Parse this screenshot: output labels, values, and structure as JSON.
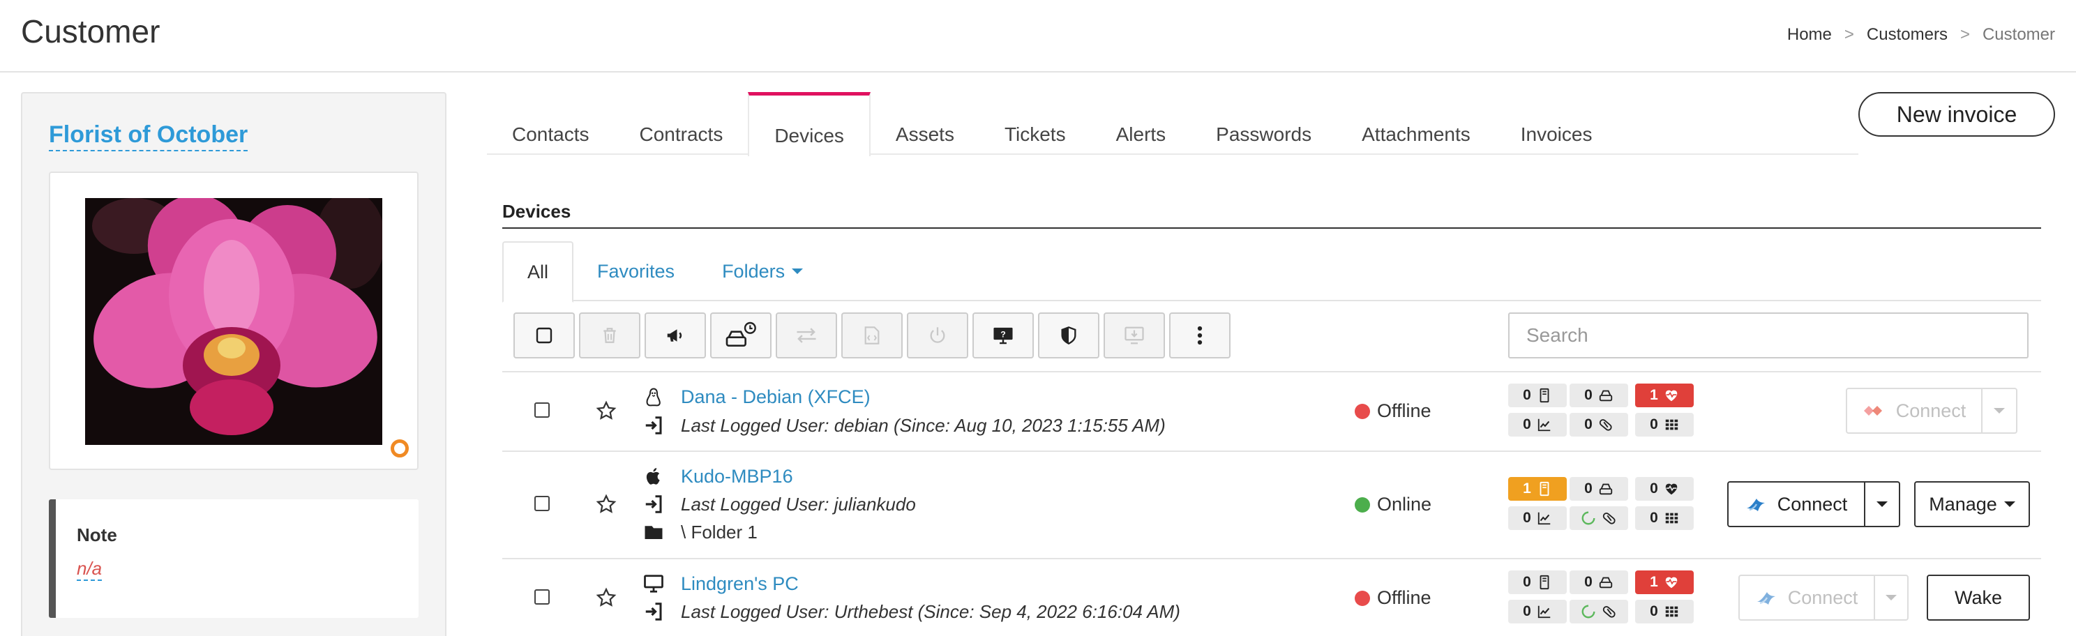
{
  "header": {
    "title": "Customer",
    "breadcrumb": [
      {
        "label": "Home"
      },
      {
        "label": "Customers"
      },
      {
        "label": "Customer"
      }
    ],
    "breadcrumb_sep": ">"
  },
  "profile": {
    "name": "Florist of October",
    "status_color": "#f08a24",
    "note_title": "Note",
    "note_value": "n/a"
  },
  "tabs": [
    {
      "label": "Contacts"
    },
    {
      "label": "Contracts"
    },
    {
      "label": "Devices",
      "active": true
    },
    {
      "label": "Assets"
    },
    {
      "label": "Tickets"
    },
    {
      "label": "Alerts"
    },
    {
      "label": "Passwords"
    },
    {
      "label": "Attachments"
    },
    {
      "label": "Invoices"
    }
  ],
  "new_invoice_label": "New invoice",
  "devices": {
    "section_title": "Devices",
    "subtabs": [
      {
        "label": "All",
        "active": true
      },
      {
        "label": "Favorites"
      },
      {
        "label": "Folders"
      }
    ],
    "search_placeholder": "Search",
    "toolbar": [
      {
        "icon": "checkbox-icon",
        "enabled": true
      },
      {
        "icon": "trash-icon",
        "enabled": false
      },
      {
        "icon": "megaphone-icon",
        "enabled": true
      },
      {
        "icon": "drive-clock-icon",
        "enabled": true
      },
      {
        "icon": "transfer-icon",
        "enabled": false
      },
      {
        "icon": "script-icon",
        "enabled": false
      },
      {
        "icon": "power-icon",
        "enabled": false
      },
      {
        "icon": "monitor-help-icon",
        "enabled": true
      },
      {
        "icon": "shield-icon",
        "enabled": true
      },
      {
        "icon": "download-install-icon",
        "enabled": false
      },
      {
        "icon": "more-vertical-icon",
        "enabled": true
      }
    ],
    "rows": [
      {
        "os_icon": "linux-icon",
        "name": "Dana - Debian (XFCE)",
        "last_user": "Last Logged User: debian (Since: Aug 10, 2023 1:15:55 AM)",
        "folder": null,
        "status": "Offline",
        "status_color": "#e84b4b",
        "badges": {
          "patches": "0",
          "drives": "0",
          "health": "1",
          "perf": "0",
          "av": "0",
          "apps": "0"
        },
        "connect_label": "Connect",
        "connect_enabled": false,
        "extra_label": null
      },
      {
        "os_icon": "apple-icon",
        "name": "Kudo-MBP16",
        "last_user": "Last Logged User: juliankudo",
        "folder": "\\ Folder 1",
        "status": "Online",
        "status_color": "#4cae4c",
        "badges": {
          "patches": "1",
          "drives": "0",
          "health": "0",
          "perf": "0",
          "av": "",
          "apps": "0"
        },
        "connect_label": "Connect",
        "connect_enabled": true,
        "extra_label": "Manage"
      },
      {
        "os_icon": "desktop-icon",
        "name": "Lindgren's PC",
        "last_user": "Last Logged User: Urthebest (Since: Sep 4, 2022 6:16:04 AM)",
        "folder": null,
        "status": "Offline",
        "status_color": "#e84b4b",
        "badges": {
          "patches": "0",
          "drives": "0",
          "health": "1",
          "perf": "0",
          "av": "",
          "apps": "0"
        },
        "connect_label": "Connect",
        "connect_enabled": false,
        "extra_label": "Wake"
      }
    ]
  }
}
